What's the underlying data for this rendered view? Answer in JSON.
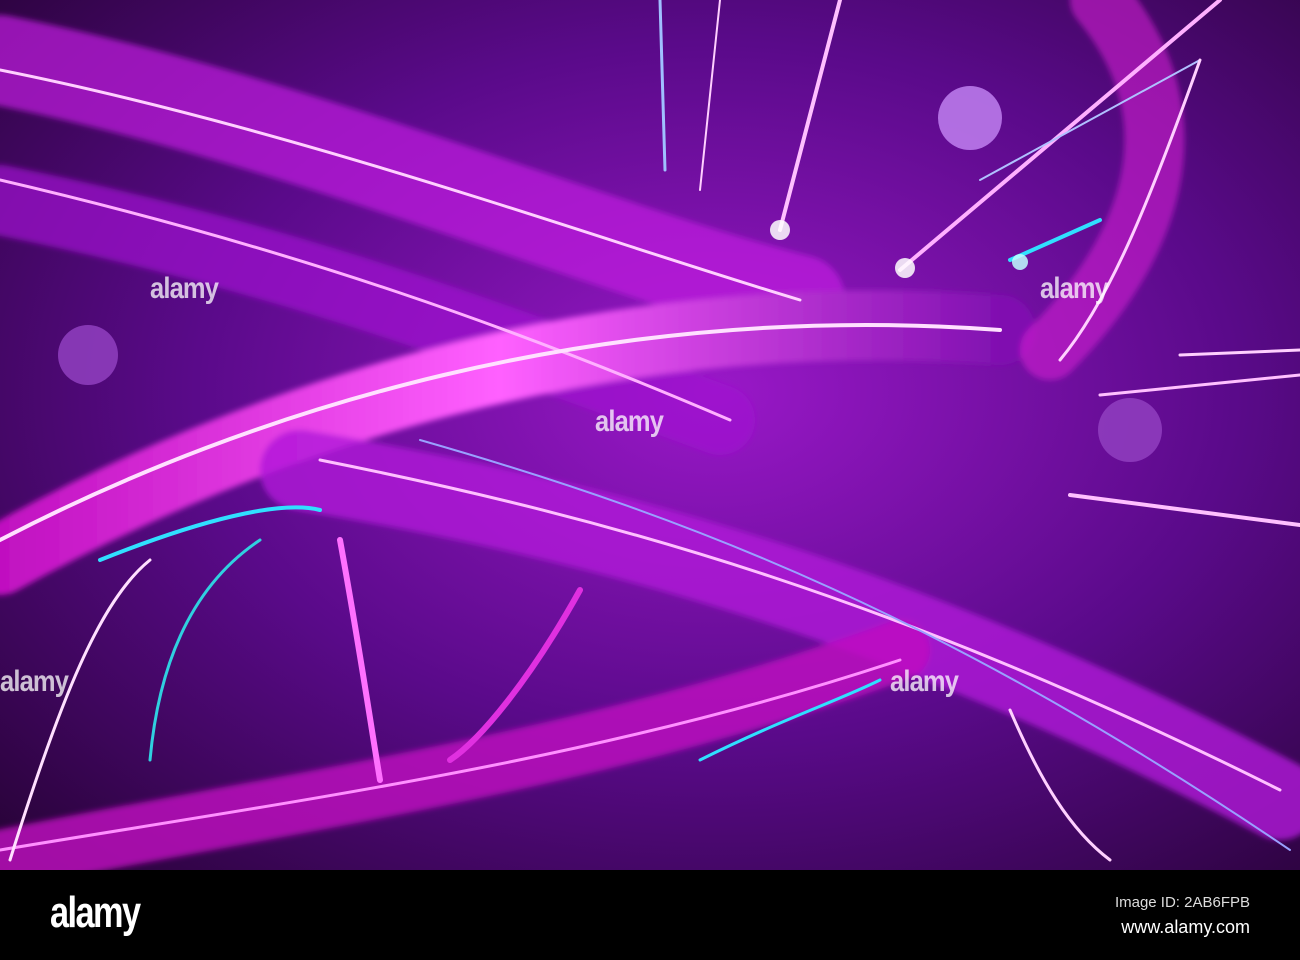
{
  "image": {
    "description_tag": "abstract-purple-light-streaks",
    "watermark_text": "alamy",
    "colors": {
      "deep": "#2a0340",
      "mid": "#7a0fb0",
      "magenta": "#e020e0",
      "cyan": "#30e0ff",
      "highlight": "#ffd0ff"
    }
  },
  "footer": {
    "logo": "alamy",
    "image_id": "Image ID: 2AB6FPB",
    "site": "www.alamy.com"
  }
}
